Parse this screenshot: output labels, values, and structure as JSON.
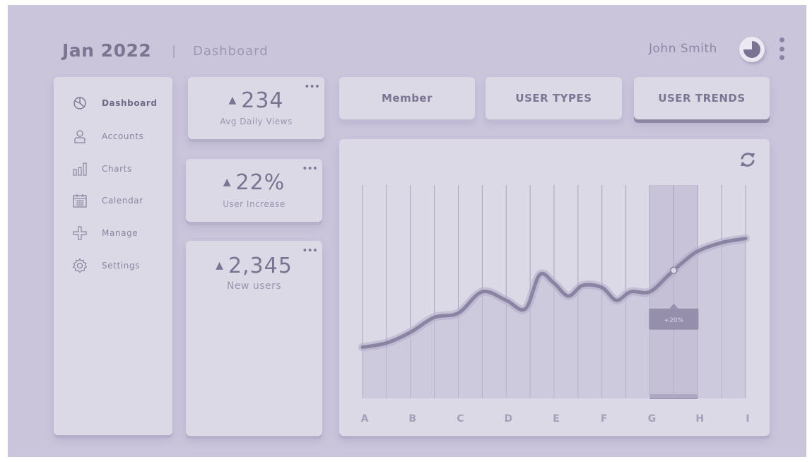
{
  "header": {
    "title": "Jan 2022",
    "separator": "|",
    "subtitle": "Dashboard",
    "user_name": "John Smith"
  },
  "sidebar": {
    "items": [
      {
        "label": "Dashboard",
        "icon": "pie-chart-icon",
        "active": true
      },
      {
        "label": "Accounts",
        "icon": "user-icon",
        "active": false
      },
      {
        "label": "Charts",
        "icon": "bar-chart-icon",
        "active": false
      },
      {
        "label": "Calendar",
        "icon": "calendar-icon",
        "active": false
      },
      {
        "label": "Manage",
        "icon": "plus-icon",
        "active": false
      },
      {
        "label": "Settings",
        "icon": "gear-icon",
        "active": false
      }
    ]
  },
  "stats": [
    {
      "value": "234",
      "caption": "Avg Daily Views",
      "menu": "•••"
    },
    {
      "value": "22%",
      "caption": "User Increase",
      "menu": "•••"
    },
    {
      "value": "2,345",
      "caption": "New users",
      "menu": "•••"
    }
  ],
  "tabs": [
    {
      "label": "Member",
      "active": false
    },
    {
      "label": "USER TYPES",
      "active": false
    },
    {
      "label": "USER TRENDS",
      "active": true
    }
  ],
  "colors": {
    "background": "#cbc5dc",
    "card": "#dcd9e6",
    "accent": "#8d86a5",
    "text": "#7b7591"
  },
  "chart_data": {
    "type": "area",
    "categories": [
      "A",
      "B",
      "C",
      "D",
      "E",
      "F",
      "G",
      "H",
      "I"
    ],
    "x": [
      0,
      0.5,
      1,
      1.5,
      2,
      2.5,
      3,
      3.4,
      3.7,
      4,
      4.3,
      4.6,
      5,
      5.3,
      5.6,
      6,
      6.4,
      6.7,
      7,
      7.5,
      8
    ],
    "values": [
      24,
      26,
      31,
      38,
      40,
      50,
      46,
      42,
      58,
      54,
      48,
      53,
      52,
      46,
      50,
      50,
      58,
      64,
      69,
      73,
      75
    ],
    "ylim": [
      0,
      100
    ],
    "highlight": {
      "category": "H",
      "label": "+20%"
    },
    "grid": "vertical"
  }
}
